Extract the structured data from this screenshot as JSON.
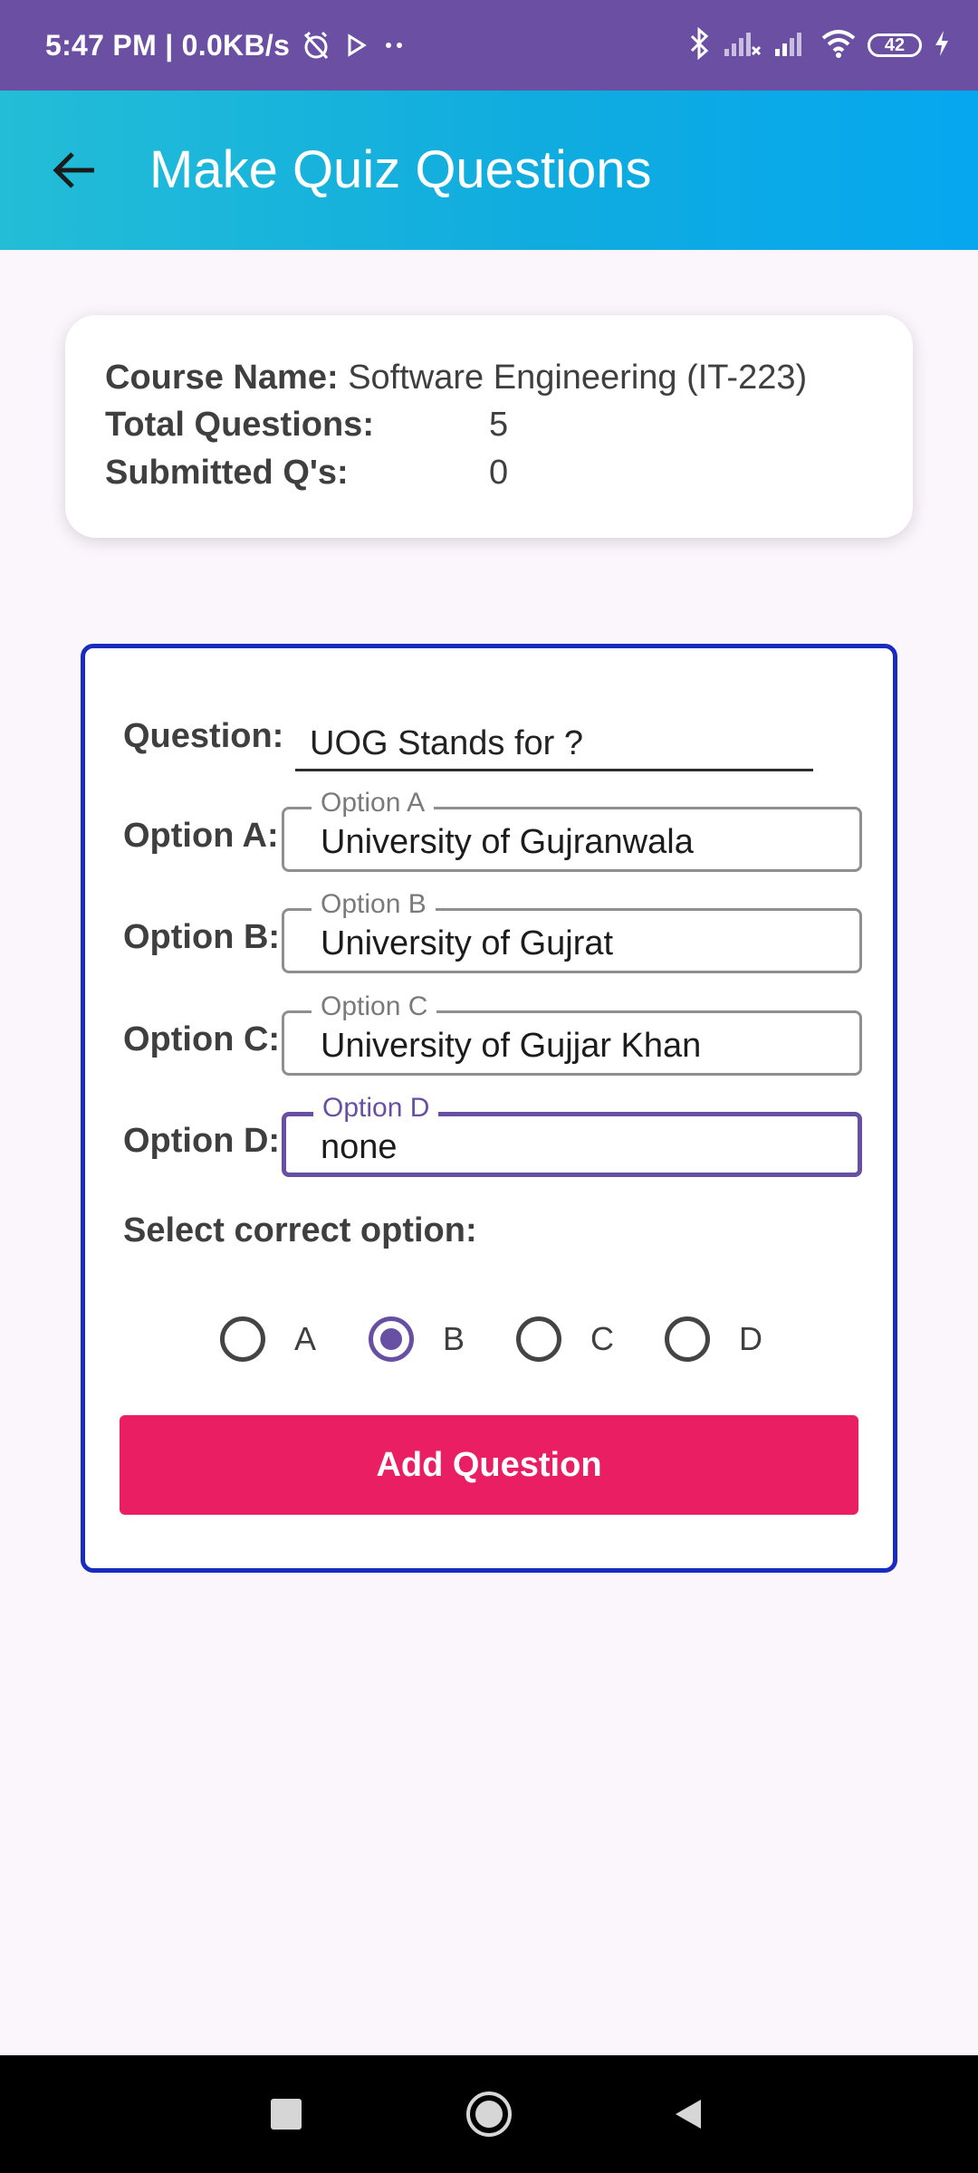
{
  "status_bar": {
    "time": "5:47 PM | 0.0KB/s",
    "battery": "42"
  },
  "app_bar": {
    "title": "Make Quiz Questions"
  },
  "info": {
    "course_label": "Course Name:",
    "course_value": "Software Engineering (IT-223)",
    "total_label": "Total Questions:",
    "total_value": "5",
    "submitted_label": "Submitted Q's:",
    "submitted_value": "0"
  },
  "form": {
    "question_label": "Question:",
    "question_value": "UOG Stands for ?",
    "options": [
      {
        "label": "Option A:",
        "hint": "Option A",
        "value": "University of Gujranwala"
      },
      {
        "label": "Option B:",
        "hint": "Option B",
        "value": "University of Gujrat"
      },
      {
        "label": "Option C:",
        "hint": "Option C",
        "value": "University of Gujjar Khan"
      },
      {
        "label": "Option D:",
        "hint": "Option D",
        "value": "none"
      }
    ],
    "select_label": "Select correct option:",
    "radios": [
      "A",
      "B",
      "C",
      "D"
    ],
    "selected": "B",
    "add_button": "Add Question"
  },
  "colors": {
    "status_bar": "#6b4fa3",
    "accent": "#6750a4",
    "form_border": "#1a2bbf",
    "button": "#e91e63"
  }
}
